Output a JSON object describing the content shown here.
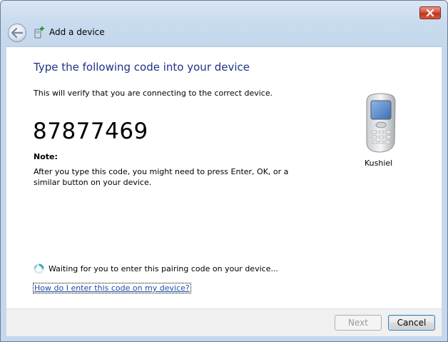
{
  "window": {
    "title": "Add a device",
    "colors": {
      "heading": "#1e3287",
      "link": "#1c4fa8",
      "close": "#c0331f"
    }
  },
  "titlebar": {
    "close_icon": "close-icon",
    "back_icon": "back-arrow-icon",
    "app_icon": "add-device-icon"
  },
  "main": {
    "heading": "Type the following code into your device",
    "description": "This will verify that you are connecting to the correct device.",
    "pairing_code": "87877469",
    "note_label": "Note:",
    "note_text": "After you type this code, you might need to press Enter, OK, or a similar button on your device.",
    "device": {
      "icon": "mobile-phone-icon",
      "name": "Kushiel"
    },
    "status_text": "Waiting for you to enter this pairing code on your device...",
    "help_link": "How do I enter this code on my device?"
  },
  "footer": {
    "next_label": "Next",
    "cancel_label": "Cancel"
  }
}
